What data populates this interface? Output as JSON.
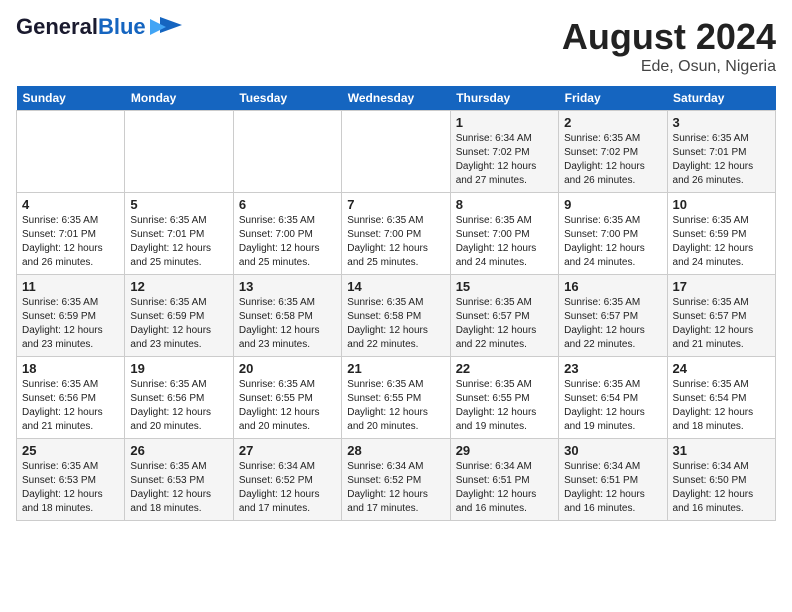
{
  "header": {
    "logo_line1": "General",
    "logo_line2": "Blue",
    "month_year": "August 2024",
    "location": "Ede, Osun, Nigeria"
  },
  "days_of_week": [
    "Sunday",
    "Monday",
    "Tuesday",
    "Wednesday",
    "Thursday",
    "Friday",
    "Saturday"
  ],
  "weeks": [
    [
      {
        "num": "",
        "info": ""
      },
      {
        "num": "",
        "info": ""
      },
      {
        "num": "",
        "info": ""
      },
      {
        "num": "",
        "info": ""
      },
      {
        "num": "1",
        "info": "Sunrise: 6:34 AM\nSunset: 7:02 PM\nDaylight: 12 hours\nand 27 minutes."
      },
      {
        "num": "2",
        "info": "Sunrise: 6:35 AM\nSunset: 7:02 PM\nDaylight: 12 hours\nand 26 minutes."
      },
      {
        "num": "3",
        "info": "Sunrise: 6:35 AM\nSunset: 7:01 PM\nDaylight: 12 hours\nand 26 minutes."
      }
    ],
    [
      {
        "num": "4",
        "info": "Sunrise: 6:35 AM\nSunset: 7:01 PM\nDaylight: 12 hours\nand 26 minutes."
      },
      {
        "num": "5",
        "info": "Sunrise: 6:35 AM\nSunset: 7:01 PM\nDaylight: 12 hours\nand 25 minutes."
      },
      {
        "num": "6",
        "info": "Sunrise: 6:35 AM\nSunset: 7:00 PM\nDaylight: 12 hours\nand 25 minutes."
      },
      {
        "num": "7",
        "info": "Sunrise: 6:35 AM\nSunset: 7:00 PM\nDaylight: 12 hours\nand 25 minutes."
      },
      {
        "num": "8",
        "info": "Sunrise: 6:35 AM\nSunset: 7:00 PM\nDaylight: 12 hours\nand 24 minutes."
      },
      {
        "num": "9",
        "info": "Sunrise: 6:35 AM\nSunset: 7:00 PM\nDaylight: 12 hours\nand 24 minutes."
      },
      {
        "num": "10",
        "info": "Sunrise: 6:35 AM\nSunset: 6:59 PM\nDaylight: 12 hours\nand 24 minutes."
      }
    ],
    [
      {
        "num": "11",
        "info": "Sunrise: 6:35 AM\nSunset: 6:59 PM\nDaylight: 12 hours\nand 23 minutes."
      },
      {
        "num": "12",
        "info": "Sunrise: 6:35 AM\nSunset: 6:59 PM\nDaylight: 12 hours\nand 23 minutes."
      },
      {
        "num": "13",
        "info": "Sunrise: 6:35 AM\nSunset: 6:58 PM\nDaylight: 12 hours\nand 23 minutes."
      },
      {
        "num": "14",
        "info": "Sunrise: 6:35 AM\nSunset: 6:58 PM\nDaylight: 12 hours\nand 22 minutes."
      },
      {
        "num": "15",
        "info": "Sunrise: 6:35 AM\nSunset: 6:57 PM\nDaylight: 12 hours\nand 22 minutes."
      },
      {
        "num": "16",
        "info": "Sunrise: 6:35 AM\nSunset: 6:57 PM\nDaylight: 12 hours\nand 22 minutes."
      },
      {
        "num": "17",
        "info": "Sunrise: 6:35 AM\nSunset: 6:57 PM\nDaylight: 12 hours\nand 21 minutes."
      }
    ],
    [
      {
        "num": "18",
        "info": "Sunrise: 6:35 AM\nSunset: 6:56 PM\nDaylight: 12 hours\nand 21 minutes."
      },
      {
        "num": "19",
        "info": "Sunrise: 6:35 AM\nSunset: 6:56 PM\nDaylight: 12 hours\nand 20 minutes."
      },
      {
        "num": "20",
        "info": "Sunrise: 6:35 AM\nSunset: 6:55 PM\nDaylight: 12 hours\nand 20 minutes."
      },
      {
        "num": "21",
        "info": "Sunrise: 6:35 AM\nSunset: 6:55 PM\nDaylight: 12 hours\nand 20 minutes."
      },
      {
        "num": "22",
        "info": "Sunrise: 6:35 AM\nSunset: 6:55 PM\nDaylight: 12 hours\nand 19 minutes."
      },
      {
        "num": "23",
        "info": "Sunrise: 6:35 AM\nSunset: 6:54 PM\nDaylight: 12 hours\nand 19 minutes."
      },
      {
        "num": "24",
        "info": "Sunrise: 6:35 AM\nSunset: 6:54 PM\nDaylight: 12 hours\nand 18 minutes."
      }
    ],
    [
      {
        "num": "25",
        "info": "Sunrise: 6:35 AM\nSunset: 6:53 PM\nDaylight: 12 hours\nand 18 minutes."
      },
      {
        "num": "26",
        "info": "Sunrise: 6:35 AM\nSunset: 6:53 PM\nDaylight: 12 hours\nand 18 minutes."
      },
      {
        "num": "27",
        "info": "Sunrise: 6:34 AM\nSunset: 6:52 PM\nDaylight: 12 hours\nand 17 minutes."
      },
      {
        "num": "28",
        "info": "Sunrise: 6:34 AM\nSunset: 6:52 PM\nDaylight: 12 hours\nand 17 minutes."
      },
      {
        "num": "29",
        "info": "Sunrise: 6:34 AM\nSunset: 6:51 PM\nDaylight: 12 hours\nand 16 minutes."
      },
      {
        "num": "30",
        "info": "Sunrise: 6:34 AM\nSunset: 6:51 PM\nDaylight: 12 hours\nand 16 minutes."
      },
      {
        "num": "31",
        "info": "Sunrise: 6:34 AM\nSunset: 6:50 PM\nDaylight: 12 hours\nand 16 minutes."
      }
    ]
  ]
}
